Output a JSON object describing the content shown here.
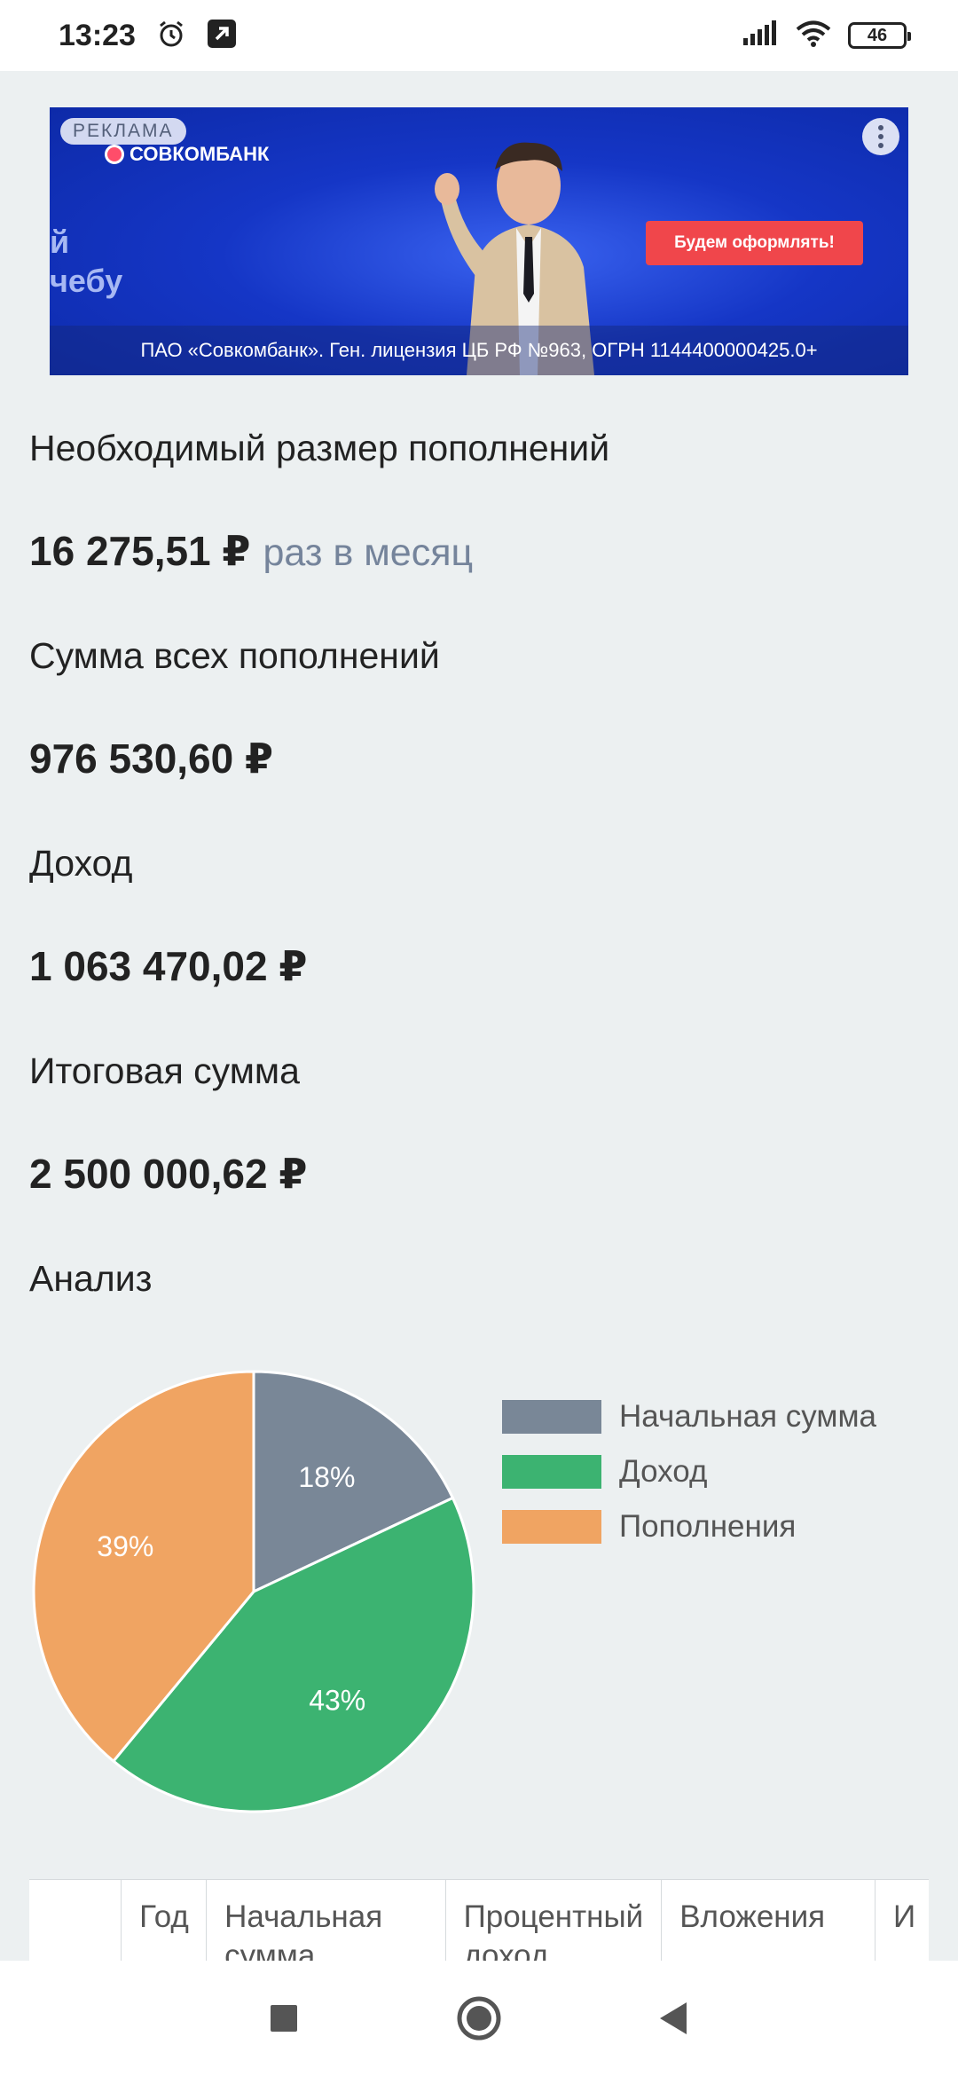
{
  "status_bar": {
    "time": "13:23",
    "battery": "46",
    "icons": [
      "alarm-icon",
      "arrow-up-right-icon",
      "signal-icon",
      "wifi-icon",
      "battery-icon"
    ]
  },
  "ad": {
    "tag": "РЕКЛАМА",
    "brand": "СОВКОМБАНК",
    "slogan": "й\nчебу",
    "cta": "Будем оформлять!",
    "legal": "ПАО «Совкомбанк». Ген. лицензия ЦБ РФ №963, ОГРН 1144400000425.0+",
    "colors": {
      "background": "#1536c6",
      "cta": "#f0464b",
      "logo": "#ff4d6a"
    }
  },
  "results": {
    "monthly_label": "Необходимый размер пополнений",
    "monthly_value": "16 275,51 ₽",
    "monthly_period": "раз в месяц",
    "total_contrib_label": "Сумма всех пополнений",
    "total_contrib_value": "976 530,60 ₽",
    "income_label": "Доход",
    "income_value": "1 063 470,02 ₽",
    "final_label": "Итоговая сумма",
    "final_value": "2 500 000,62 ₽"
  },
  "analysis": {
    "title": "Анализ"
  },
  "chart_data": {
    "type": "pie",
    "categories": [
      "Начальная сумма",
      "Доход",
      "Пополнения"
    ],
    "values": [
      18,
      43,
      39
    ],
    "labels": [
      "18%",
      "43%",
      "39%"
    ],
    "colors": [
      "#798797",
      "#3cb371",
      "#f0a462"
    ],
    "legend_position": "right"
  },
  "table": {
    "headers": [
      "",
      "Год",
      "Начальная сумма",
      "Процентный доход",
      "Вложения",
      "И"
    ]
  },
  "nav": {
    "icons": [
      "recents-icon",
      "home-icon",
      "back-icon"
    ]
  }
}
